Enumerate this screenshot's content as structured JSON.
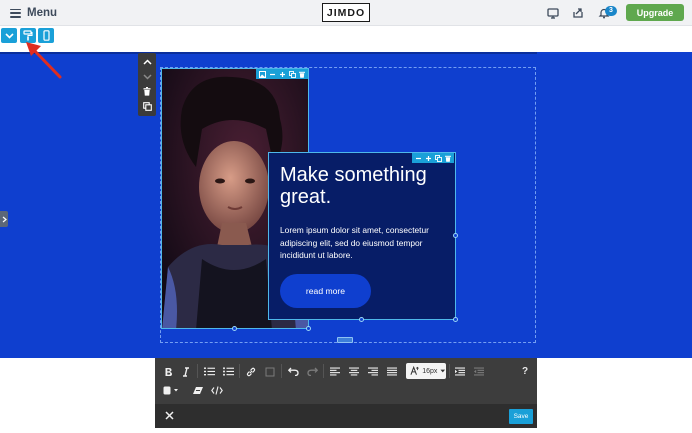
{
  "topbar": {
    "menu_label": "Menu",
    "logo_text": "JIMDO",
    "notification_count": "3",
    "upgrade_label": "Upgrade"
  },
  "view_toolbar": {
    "icons": [
      "chevron-down-icon",
      "paint-roller-icon",
      "mobile-icon"
    ]
  },
  "content": {
    "headline": "Make something great.",
    "body": "Lorem ipsum dolor sit amet, consectetur adipiscing elit, sed do eiusmod tempor incididunt ut labore.",
    "cta_label": "read more"
  },
  "editor_toolbar": {
    "font_size": "16px",
    "help_label": "?",
    "save_label": "Save"
  },
  "colors": {
    "accent": "#1aa0d8",
    "canvas_blue": "#0f3fcf",
    "textbox_bg": "#071d67",
    "upgrade_green": "#5fa84e",
    "annotation_red": "#e02d1f"
  }
}
